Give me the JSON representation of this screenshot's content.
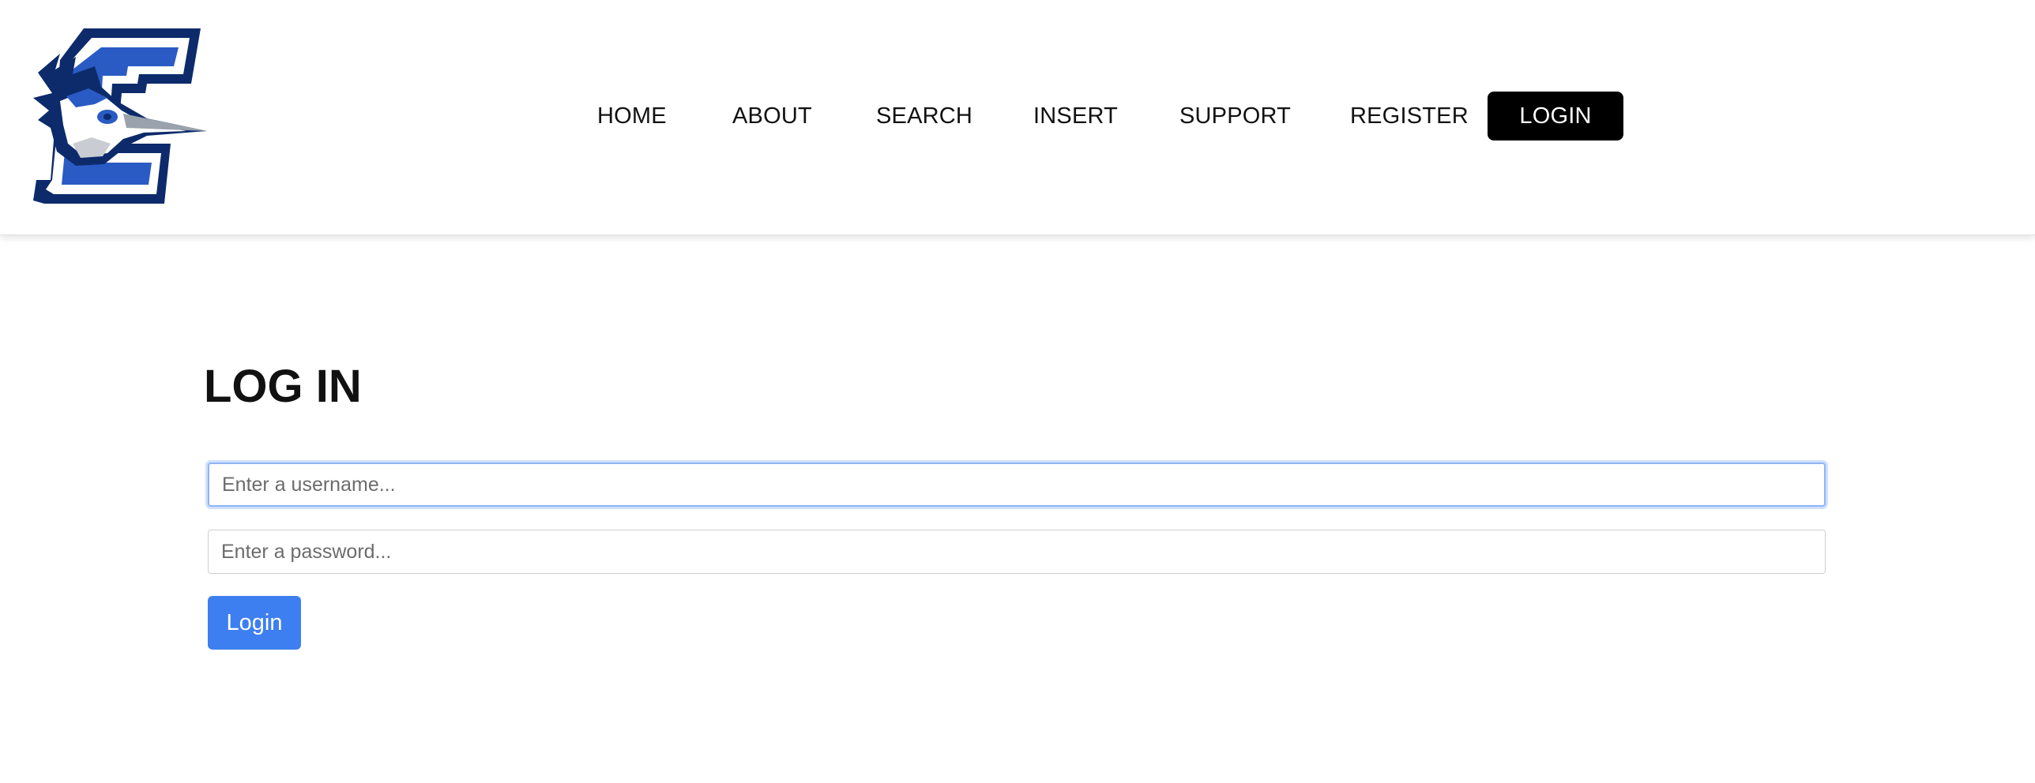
{
  "header": {
    "logo_name": "creighton-bluejay-logo",
    "nav": [
      {
        "label": "HOME"
      },
      {
        "label": "ABOUT"
      },
      {
        "label": "SEARCH"
      },
      {
        "label": "INSERT"
      },
      {
        "label": "SUPPORT"
      },
      {
        "label": "REGISTER"
      },
      {
        "label": "LOGIN",
        "active": true
      }
    ]
  },
  "main": {
    "title": "LOG IN",
    "username": {
      "placeholder": "Enter a username...",
      "value": ""
    },
    "password": {
      "placeholder": "Enter a password...",
      "value": ""
    },
    "login_button": "Login"
  },
  "colors": {
    "primary_button": "#3d7ff0",
    "active_nav_bg": "#000000",
    "logo_navy": "#0d2b6b",
    "logo_blue": "#2a5bc4"
  }
}
